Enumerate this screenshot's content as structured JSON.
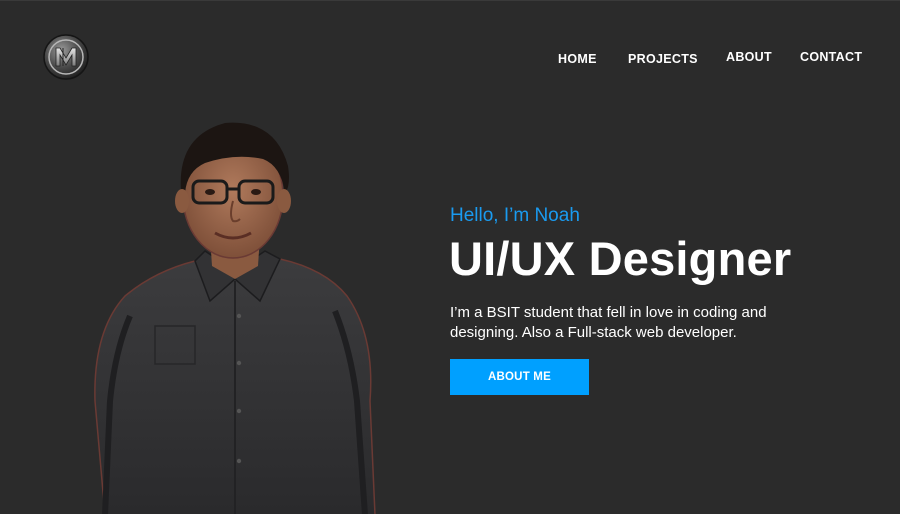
{
  "nav": {
    "items": [
      {
        "label": "HOME"
      },
      {
        "label": "PROJECTS"
      },
      {
        "label": "ABOUT"
      },
      {
        "label": "CONTACT"
      }
    ]
  },
  "logo": {
    "icon": "nm-monogram-icon"
  },
  "hero": {
    "greeting": "Hello, I’m Noah",
    "headline": "UI/UX Designer",
    "description": "I’m a BSIT student that fell in love in coding and designing. Also a Full-stack web developer.",
    "cta_label": "ABOUT ME"
  },
  "colors": {
    "background": "#2b2b2b",
    "accent": "#00a0ff",
    "greeting": "#1a9bf0",
    "text": "#ffffff"
  }
}
